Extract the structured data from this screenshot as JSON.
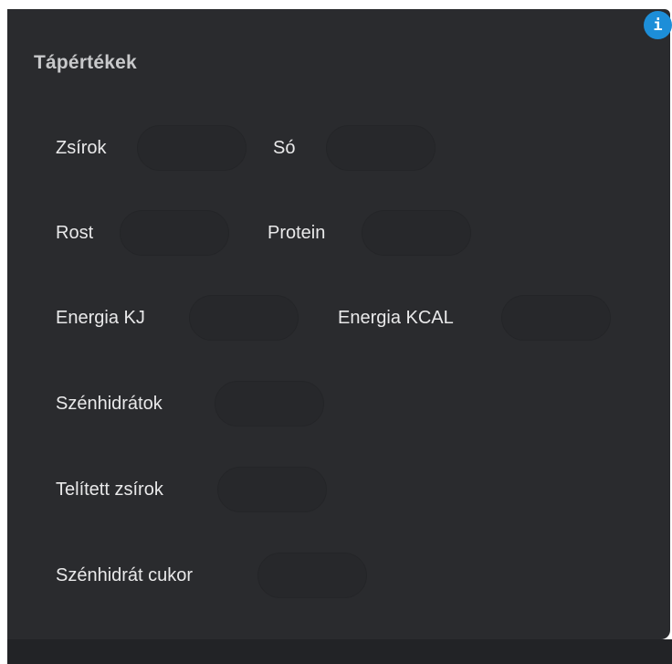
{
  "panel": {
    "title": "Tápértékek",
    "info_icon": "i"
  },
  "fields": {
    "fat": {
      "label": "Zsírok",
      "value": "",
      "placeholder": ""
    },
    "salt": {
      "label": "Só",
      "value": "",
      "placeholder": ""
    },
    "fiber": {
      "label": "Rost",
      "value": "",
      "placeholder": ""
    },
    "protein": {
      "label": "Protein",
      "value": "",
      "placeholder": ""
    },
    "energy_kj": {
      "label": "Energia KJ",
      "value": "",
      "placeholder": ""
    },
    "energy_kcal": {
      "label": "Energia KCAL",
      "value": "",
      "placeholder": ""
    },
    "carbohydrates": {
      "label": "Szénhidrátok",
      "value": "",
      "placeholder": ""
    },
    "saturated_fat": {
      "label": "Telített zsírok",
      "value": "",
      "placeholder": ""
    },
    "sugar": {
      "label": "Szénhidrát cukor",
      "value": "",
      "placeholder": ""
    }
  },
  "colors": {
    "panel_background": "#2a2b2e",
    "field_background": "#27282b",
    "title_text": "#c8c9cb",
    "label_text": "#e9e9ea",
    "info_accent": "#1d8ed8"
  }
}
